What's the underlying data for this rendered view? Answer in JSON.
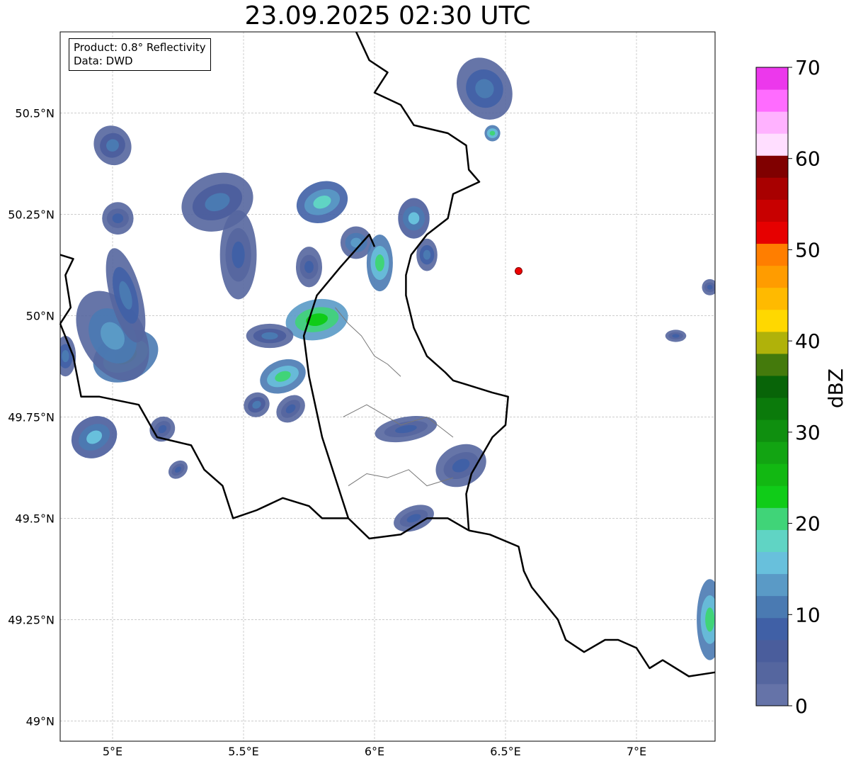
{
  "title": "23.09.2025 02:30 UTC",
  "info": {
    "product": "Product: 0.8° Reflectivity",
    "data": "Data: DWD"
  },
  "axes": {
    "lon_ticks": [
      {
        "value": 5.0,
        "label": "5°E"
      },
      {
        "value": 5.5,
        "label": "5.5°E"
      },
      {
        "value": 6.0,
        "label": "6°E"
      },
      {
        "value": 6.5,
        "label": "6.5°E"
      },
      {
        "value": 7.0,
        "label": "7°E"
      }
    ],
    "lat_ticks": [
      {
        "value": 50.5,
        "label": "50.5°N"
      },
      {
        "value": 50.25,
        "label": "50.25°N"
      },
      {
        "value": 50.0,
        "label": "50°N"
      },
      {
        "value": 49.75,
        "label": "49.75°N"
      },
      {
        "value": 49.5,
        "label": "49.5°N"
      },
      {
        "value": 49.25,
        "label": "49.25°N"
      },
      {
        "value": 49.0,
        "label": "49°N"
      }
    ],
    "lon_range": [
      4.8,
      7.3
    ],
    "lat_range": [
      48.95,
      50.7
    ]
  },
  "colorbar": {
    "label": "dBZ",
    "min": 0,
    "max": 70,
    "ticks": [
      {
        "value": 0,
        "label": "0"
      },
      {
        "value": 10,
        "label": "10"
      },
      {
        "value": 20,
        "label": "20"
      },
      {
        "value": 30,
        "label": "30"
      },
      {
        "value": 40,
        "label": "40"
      },
      {
        "value": 50,
        "label": "50"
      },
      {
        "value": 60,
        "label": "60"
      },
      {
        "value": 70,
        "label": "70"
      }
    ],
    "colors": [
      "#6573a8",
      "#55669f",
      "#4a5d9c",
      "#4060a6",
      "#4a7ab2",
      "#5a9ac6",
      "#68c0dc",
      "#60d4c4",
      "#40d478",
      "#10cc18",
      "#12b812",
      "#12a412",
      "#0f8f0f",
      "#0b7a0b",
      "#086408",
      "#447a0c",
      "#b0b20a",
      "#ffd800",
      "#ffba00",
      "#ff9c00",
      "#ff7e00",
      "#e60000",
      "#c80000",
      "#a80000",
      "#800000",
      "#ffdeff",
      "#ffb2ff",
      "#ff6cff",
      "#ec38ec"
    ]
  },
  "marker": {
    "lon": 6.55,
    "lat": 50.11,
    "color": "#ee0000"
  },
  "echoes": [
    {
      "lon": 5.05,
      "lat": 49.9,
      "rlon": 0.13,
      "rlat": 0.06,
      "rot": -25,
      "level": 22
    },
    {
      "lon": 5.0,
      "lat": 49.95,
      "rlon": 0.12,
      "rlat": 0.12,
      "rot": -30,
      "level": 14
    },
    {
      "lon": 4.93,
      "lat": 49.7,
      "rlon": 0.09,
      "rlat": 0.05,
      "rot": -30,
      "level": 16
    },
    {
      "lon": 5.05,
      "lat": 50.05,
      "rlon": 0.06,
      "rlat": 0.12,
      "rot": -15,
      "level": 12
    },
    {
      "lon": 4.82,
      "lat": 49.9,
      "rlon": 0.04,
      "rlat": 0.05,
      "rot": 0,
      "level": 12
    },
    {
      "lon": 5.0,
      "lat": 50.42,
      "rlon": 0.07,
      "rlat": 0.05,
      "rot": -30,
      "level": 10
    },
    {
      "lon": 5.02,
      "lat": 50.24,
      "rlon": 0.06,
      "rlat": 0.04,
      "rot": 0,
      "level": 8
    },
    {
      "lon": 5.4,
      "lat": 50.28,
      "rlon": 0.14,
      "rlat": 0.07,
      "rot": -20,
      "level": 10
    },
    {
      "lon": 5.48,
      "lat": 50.15,
      "rlon": 0.07,
      "rlat": 0.11,
      "rot": 0,
      "level": 8
    },
    {
      "lon": 5.75,
      "lat": 50.12,
      "rlon": 0.05,
      "rlat": 0.05,
      "rot": 0,
      "level": 8
    },
    {
      "lon": 5.8,
      "lat": 50.28,
      "rlon": 0.1,
      "rlat": 0.05,
      "rot": -20,
      "level": 18
    },
    {
      "lon": 5.93,
      "lat": 50.18,
      "rlon": 0.06,
      "rlat": 0.04,
      "rot": 0,
      "level": 14
    },
    {
      "lon": 6.02,
      "lat": 50.13,
      "rlon": 0.05,
      "rlat": 0.07,
      "rot": 0,
      "level": 20
    },
    {
      "lon": 5.78,
      "lat": 49.99,
      "rlon": 0.12,
      "rlat": 0.05,
      "rot": -10,
      "level": 24
    },
    {
      "lon": 5.6,
      "lat": 49.95,
      "rlon": 0.09,
      "rlat": 0.03,
      "rot": 0,
      "level": 10
    },
    {
      "lon": 5.65,
      "lat": 49.85,
      "rlon": 0.09,
      "rlat": 0.04,
      "rot": -20,
      "level": 20
    },
    {
      "lon": 5.55,
      "lat": 49.78,
      "rlon": 0.05,
      "rlat": 0.03,
      "rot": -30,
      "level": 10
    },
    {
      "lon": 5.68,
      "lat": 49.77,
      "rlon": 0.06,
      "rlat": 0.03,
      "rot": -40,
      "level": 8
    },
    {
      "lon": 6.15,
      "lat": 50.24,
      "rlon": 0.06,
      "rlat": 0.05,
      "rot": 0,
      "level": 16
    },
    {
      "lon": 6.2,
      "lat": 50.15,
      "rlon": 0.04,
      "rlat": 0.04,
      "rot": 0,
      "level": 12
    },
    {
      "lon": 6.12,
      "lat": 49.72,
      "rlon": 0.12,
      "rlat": 0.03,
      "rot": -10,
      "level": 8
    },
    {
      "lon": 6.33,
      "lat": 49.63,
      "rlon": 0.1,
      "rlat": 0.05,
      "rot": -25,
      "level": 8
    },
    {
      "lon": 6.15,
      "lat": 49.5,
      "rlon": 0.08,
      "rlat": 0.03,
      "rot": -20,
      "level": 8
    },
    {
      "lon": 6.42,
      "lat": 50.56,
      "rlon": 0.1,
      "rlat": 0.08,
      "rot": -30,
      "level": 12
    },
    {
      "lon": 6.45,
      "lat": 50.45,
      "rlon": 0.03,
      "rlat": 0.02,
      "rot": 0,
      "level": 20
    },
    {
      "lon": 7.28,
      "lat": 49.25,
      "rlon": 0.05,
      "rlat": 0.1,
      "rot": 0,
      "level": 20
    },
    {
      "lon": 5.19,
      "lat": 49.72,
      "rlon": 0.05,
      "rlat": 0.03,
      "rot": -40,
      "level": 8
    },
    {
      "lon": 5.25,
      "lat": 49.62,
      "rlon": 0.04,
      "rlat": 0.02,
      "rot": -40,
      "level": 8
    },
    {
      "lon": 7.15,
      "lat": 49.95,
      "rlon": 0.04,
      "rlat": 0.015,
      "rot": 0,
      "level": 8
    },
    {
      "lon": 7.28,
      "lat": 50.07,
      "rlon": 0.03,
      "rlat": 0.02,
      "rot": 0,
      "level": 8
    }
  ]
}
